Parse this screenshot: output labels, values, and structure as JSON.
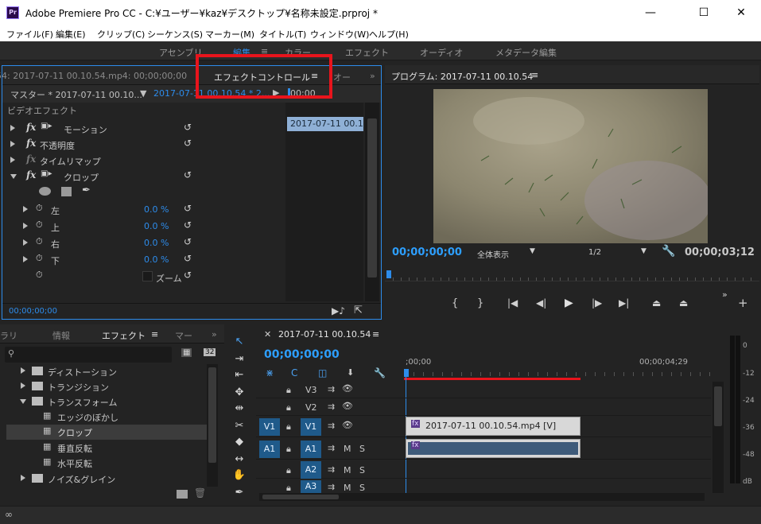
{
  "window": {
    "title": "Adobe Premiere Pro CC - C:¥ユーザー¥kaz¥デスクトップ¥名称未設定.prproj *",
    "logo": "Pr",
    "minimize": "—",
    "maximize": "☐",
    "close": "✕"
  },
  "menu": [
    "ファイル(F)",
    "編集(E)",
    "クリップ(C)",
    "シーケンス(S)",
    "マーカー(M)",
    "タイトル(T)",
    "ウィンドウ(W)",
    "ヘルプ(H)"
  ],
  "workspaces": [
    "アセンブリ",
    "編集",
    "カラー",
    "エフェクト",
    "オーディオ",
    "メタデータ編集"
  ],
  "source_panel": {
    "tab_left": "54: 2017-07-11 00.10.54.mp4: 00;00;00;00",
    "tab_active": "エフェクトコントロール",
    "tab_right": "オー",
    "master": "マスター * 2017-07-11 00.10...",
    "clip": "2017-07-11 00.10.54 * 2...",
    "timecode_head": "00;00",
    "clip_bar": "2017-07-11 00.10.5",
    "video_effects": "ビデオエフェクト",
    "effects": [
      {
        "name": "モーション"
      },
      {
        "name": "不透明度"
      },
      {
        "name": "タイムリマップ"
      },
      {
        "name": "クロップ"
      }
    ],
    "params": [
      {
        "name": "左",
        "value": "0.0 %"
      },
      {
        "name": "上",
        "value": "0.0 %"
      },
      {
        "name": "右",
        "value": "0.0 %"
      },
      {
        "name": "下",
        "value": "0.0 %"
      }
    ],
    "zoom_label": "ズーム",
    "footer_time": "00;00;00;00"
  },
  "program_panel": {
    "title": "プログラム: 2017-07-11 00.10.54",
    "timecode": "00;00;00;00",
    "fit": "全体表示",
    "resolution": "1/2",
    "duration": "00;00;03;12",
    "buttons": [
      "{",
      "}",
      "|◀",
      "◀|",
      "▶",
      "|▶",
      "▶|"
    ]
  },
  "effects_panel": {
    "tabs": [
      "ラリ",
      "情報",
      "エフェクト",
      "マー"
    ],
    "tree": [
      {
        "label": "ディストーション",
        "level": 1,
        "type": "folder"
      },
      {
        "label": "トランジション",
        "level": 1,
        "type": "folder"
      },
      {
        "label": "トランスフォーム",
        "level": 1,
        "type": "folder",
        "open": true
      },
      {
        "label": "エッジのぼかし",
        "level": 2,
        "type": "effect"
      },
      {
        "label": "クロップ",
        "level": 2,
        "type": "effect",
        "selected": true
      },
      {
        "label": "垂直反転",
        "level": 2,
        "type": "effect"
      },
      {
        "label": "水平反転",
        "level": 2,
        "type": "effect"
      },
      {
        "label": "ノイズ&グレイン",
        "level": 1,
        "type": "folder"
      }
    ]
  },
  "timeline": {
    "tab": "2017-07-11 00.10.54",
    "timecode": "00;00;00;00",
    "ruler_start": ";00;00",
    "ruler_end": "00;00;04;29",
    "tracks": [
      {
        "id": "V3",
        "kind": "video"
      },
      {
        "id": "V2",
        "kind": "video"
      },
      {
        "id": "V1",
        "kind": "video",
        "source": "V1"
      },
      {
        "id": "A1",
        "kind": "audio",
        "source": "A1"
      },
      {
        "id": "A2",
        "kind": "audio"
      },
      {
        "id": "A3",
        "kind": "audio"
      }
    ],
    "video_clip": "2017-07-11 00.10.54.mp4 [V]",
    "mute": "M",
    "solo": "S"
  },
  "meter": {
    "labels": [
      "0",
      "-12",
      "-24",
      "-36",
      "-48",
      "dB"
    ]
  },
  "colors": {
    "accent": "#2d8ceb",
    "highlight_box": "#e8141c",
    "panel_border": "#2d8ceb"
  }
}
